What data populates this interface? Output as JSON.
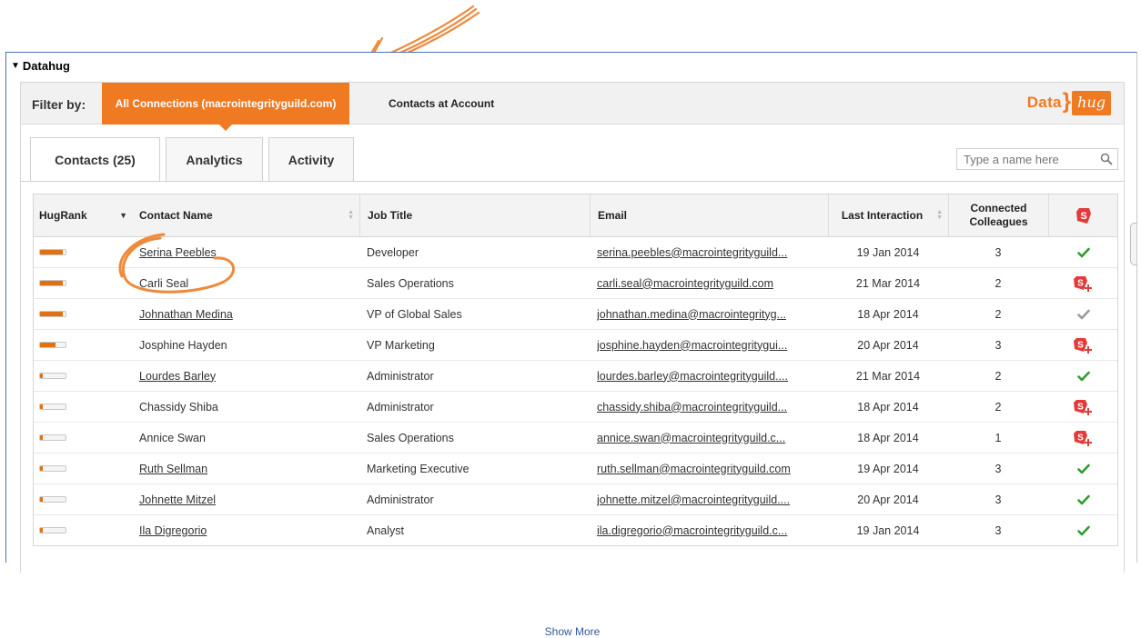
{
  "panel": {
    "title": "Datahug"
  },
  "filter": {
    "label": "Filter by:",
    "options": [
      "All Connections (macrointegrityguild.com)",
      "Contacts at Account"
    ],
    "active_index": 0
  },
  "logo": {
    "left": "Data",
    "right": "hug"
  },
  "tabs": [
    {
      "label": "Contacts (25)",
      "active": true
    },
    {
      "label": "Analytics",
      "active": false
    },
    {
      "label": "Activity",
      "active": false
    }
  ],
  "search": {
    "placeholder": "Type a name here",
    "icon": "search-icon"
  },
  "table": {
    "columns": [
      "HugRank",
      "Contact Name",
      "Job Title",
      "Email",
      "Last Interaction",
      "Connected Colleagues"
    ],
    "action_header_icon": "add-to-crm-icon",
    "rows": [
      {
        "hugrank": 0.9,
        "name": "Serina Peebles",
        "linked": true,
        "job": "Developer",
        "email": "serina.peebles@macrointegrityguild...",
        "last": "19 Jan 2014",
        "colleagues": "3",
        "status": "check-green"
      },
      {
        "hugrank": 0.9,
        "name": "Carli Seal",
        "linked": false,
        "job": "Sales Operations",
        "email": "carli.seal@macrointegrityguild.com",
        "last": "21 Mar 2014",
        "colleagues": "2",
        "status": "add"
      },
      {
        "hugrank": 0.9,
        "name": "Johnathan Medina",
        "linked": true,
        "job": "VP of Global Sales",
        "email": "johnathan.medina@macrointegrityg...",
        "last": "18 Apr 2014",
        "colleagues": "2",
        "status": "check-grey"
      },
      {
        "hugrank": 0.6,
        "name": "Josphine Hayden",
        "linked": false,
        "job": "VP Marketing",
        "email": "josphine.hayden@macrointegritygui...",
        "last": "20 Apr 2014",
        "colleagues": "3",
        "status": "add"
      },
      {
        "hugrank": 0.1,
        "name": "Lourdes Barley",
        "linked": true,
        "job": "Administrator",
        "email": "lourdes.barley@macrointegrityguild....",
        "last": "21 Mar 2014",
        "colleagues": "2",
        "status": "check-green"
      },
      {
        "hugrank": 0.1,
        "name": "Chassidy Shiba",
        "linked": false,
        "job": "Administrator",
        "email": "chassidy.shiba@macrointegrityguild...",
        "last": "18 Apr 2014",
        "colleagues": "2",
        "status": "add"
      },
      {
        "hugrank": 0.1,
        "name": "Annice Swan",
        "linked": false,
        "job": "Sales Operations",
        "email": "annice.swan@macrointegrityguild.c...",
        "last": "18 Apr 2014",
        "colleagues": "1",
        "status": "add"
      },
      {
        "hugrank": 0.1,
        "name": "Ruth Sellman",
        "linked": true,
        "job": "Marketing Executive",
        "email": "ruth.sellman@macrointegrityguild.com",
        "last": "19 Apr 2014",
        "colleagues": "3",
        "status": "check-green"
      },
      {
        "hugrank": 0.1,
        "name": "Johnette Mitzel",
        "linked": true,
        "job": "Administrator",
        "email": "johnette.mitzel@macrointegrityguild....",
        "last": "20 Apr 2014",
        "colleagues": "3",
        "status": "check-green"
      },
      {
        "hugrank": 0.1,
        "name": "Ila Digregorio",
        "linked": true,
        "job": "Analyst",
        "email": "ila.digregorio@macrointegrityguild.c...",
        "last": "19 Jan 2014",
        "colleagues": "3",
        "status": "check-green"
      }
    ]
  },
  "show_more": "Show More",
  "colors": {
    "accent": "#ef7a22",
    "crm_red": "#e23b3b",
    "check_green": "#2e9e2e",
    "check_grey": "#9a9a9a"
  }
}
